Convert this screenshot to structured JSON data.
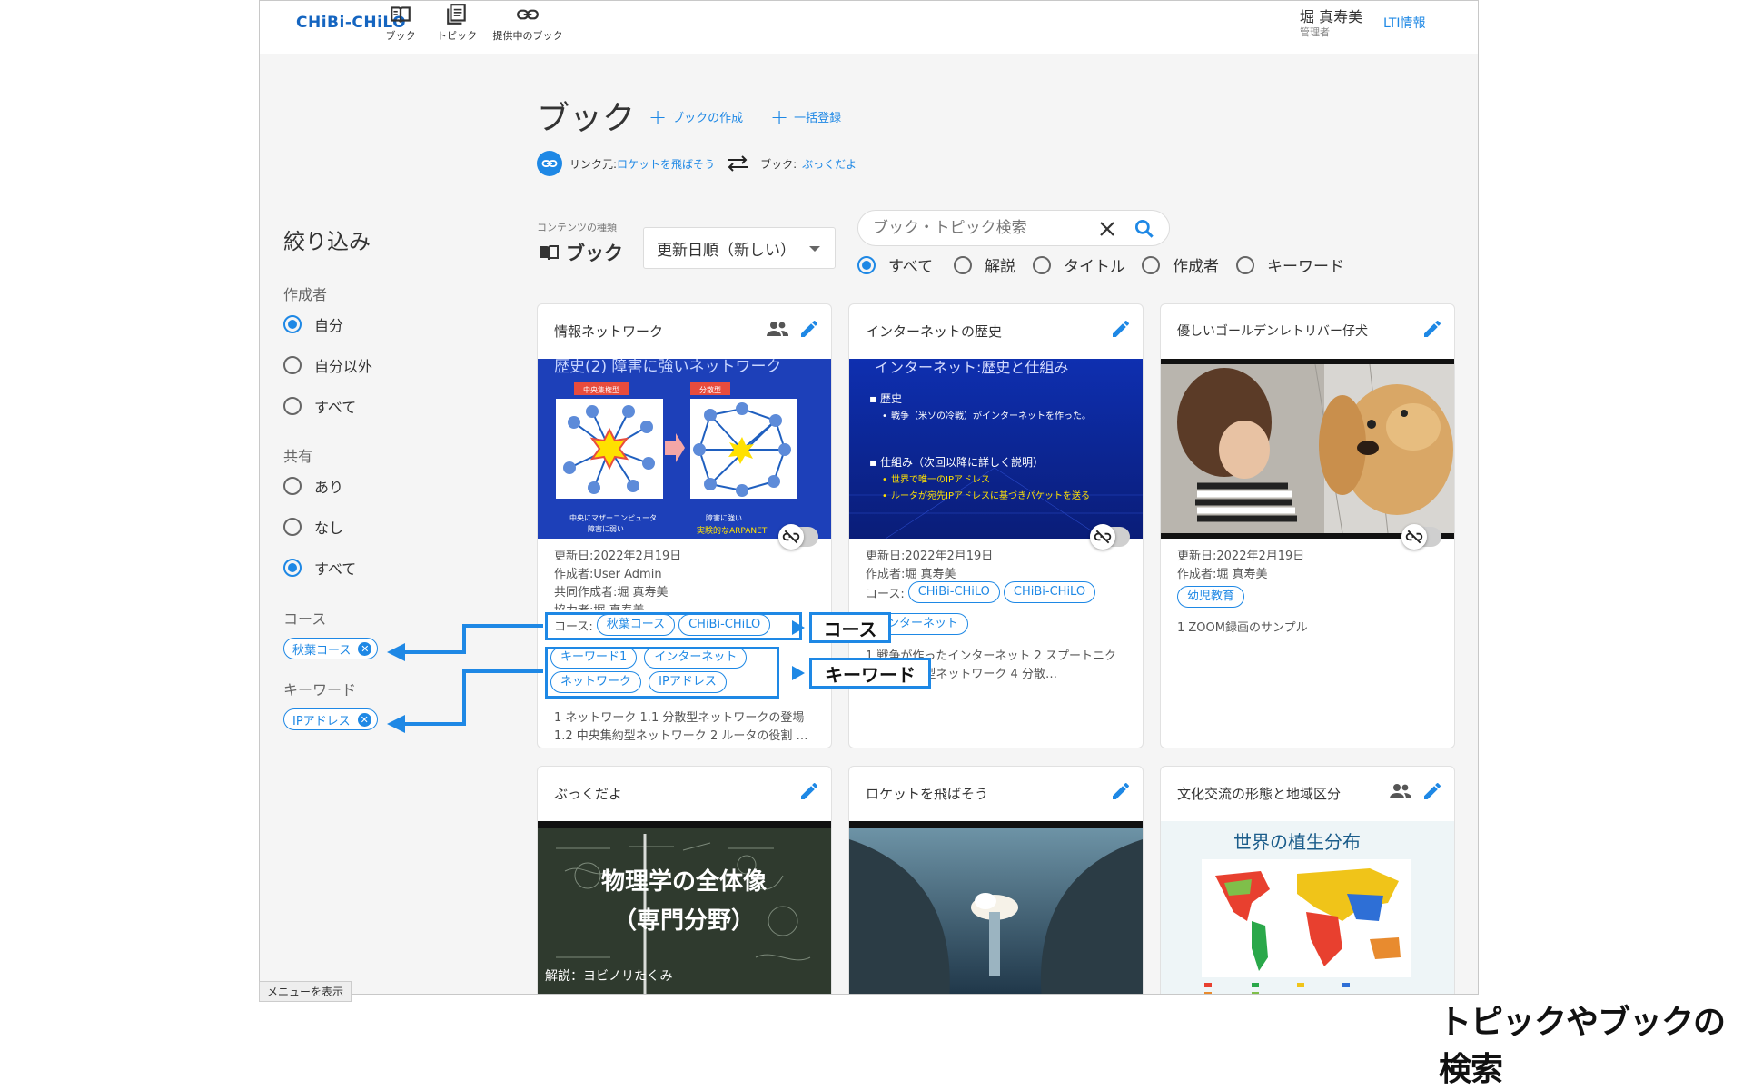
{
  "header": {
    "logo": "CHiBi-CHiLO",
    "nav": [
      {
        "label": "ブック",
        "icon": "book-icon"
      },
      {
        "label": "トピック",
        "icon": "topic-icon"
      },
      {
        "label": "提供中のブック",
        "icon": "link-icon"
      }
    ],
    "user_name": "堀 真寿美",
    "user_role": "管理者",
    "lti": "LTI情報"
  },
  "page": {
    "title": "ブック",
    "create": "ブックの作成",
    "bulk": "一括登録",
    "link_from_label": "リンク元:",
    "link_from_value": "ロケットを飛ばそう",
    "link_to_label": "ブック:",
    "link_to_value": "ぶっくだよ"
  },
  "sidebar": {
    "title": "絞り込み",
    "author_label": "作成者",
    "author_options": [
      "自分",
      "自分以外",
      "すべて"
    ],
    "author_selected": "自分",
    "share_label": "共有",
    "share_options": [
      "あり",
      "なし",
      "すべて"
    ],
    "share_selected": "すべて",
    "course_label": "コース",
    "course_chip": "秋葉コース",
    "keyword_label": "キーワード",
    "keyword_chip": "IPアドレス"
  },
  "toolbar": {
    "content_type_label": "コンテンツの種類",
    "content_type_value": "ブック",
    "sort": "更新日順（新しい）",
    "search_placeholder": "ブック・トピック検索",
    "search_options": [
      "すべて",
      "解説",
      "タイトル",
      "作成者",
      "キーワード"
    ],
    "search_selected": "すべて"
  },
  "cards": [
    {
      "title": "情報ネットワーク",
      "updated": "更新日:2022年2月19日",
      "author": "作成者:User Admin",
      "coauthor": "共同作成者:堀 真寿美",
      "contributor": "協力者:堀 真寿美",
      "course_prefix": "コース:",
      "courses": [
        "秋葉コース",
        "CHiBi-CHiLO"
      ],
      "keywords": [
        "キーワード1",
        "インターネット",
        "ネットワーク",
        "IPアドレス"
      ],
      "toc1": "1 ネットワーク 1.1 分散型ネットワークの登場",
      "toc2": "1.2 中央集約型ネットワーク 2 ルータの役割 …",
      "slide_title": "歴史(2) 障害に強いネットワーク",
      "slide_left": "中央集権型",
      "slide_right": "分散型",
      "slide_cap1": "中央にマザーコンピュータ",
      "slide_cap2": "障害に弱い",
      "slide_cap3": "障害に強い",
      "slide_cap4": "実験的なARPANET"
    },
    {
      "title": "インターネットの歴史",
      "updated": "更新日:2022年2月19日",
      "author": "作成者:堀 真寿美",
      "course_prefix": "コース:",
      "courses": [
        "CHiBi-CHiLO",
        "CHiBi-CHiLO"
      ],
      "keywords": [
        "インターネット"
      ],
      "toc1": "1 戦争が作ったインターネット 2 スプートニク",
      "toc2": "3 中央集約型ネットワーク 4 分散…",
      "slide_title": "インターネット:歴史と仕組み",
      "slide_b1": "歴史",
      "slide_b1a": "戦争（米ソの冷戦）がインターネットを作った。",
      "slide_b2": "仕組み（次回以降に詳しく説明）",
      "slide_b2a": "世界で唯一のIPアドレス",
      "slide_b2b": "ルータが宛先IPアドレスに基づきパケットを送る"
    },
    {
      "title": "優しいゴールデンレトリバー仔犬",
      "updated": "更新日:2022年2月19日",
      "author": "作成者:堀 真寿美",
      "keywords": [
        "幼児教育"
      ],
      "toc1": "1 ZOOM録画のサンプル"
    },
    {
      "title": "ぶっくだよ",
      "slide_t1": "物理学の全体像",
      "slide_t2": "（専門分野）",
      "slide_t3": "解説：ヨビノリたくみ"
    },
    {
      "title": "ロケットを飛ばそう"
    },
    {
      "title": "文化交流の形態と地域区分",
      "slide_title": "世界の植生分布"
    }
  ],
  "callouts": {
    "course": "コース",
    "keyword": "キーワード"
  },
  "bottom_menu": "メニューを表示",
  "caption": "トピックやブックの検索",
  "colors": {
    "accent": "#1e88e5",
    "logo": "#1565c0"
  }
}
